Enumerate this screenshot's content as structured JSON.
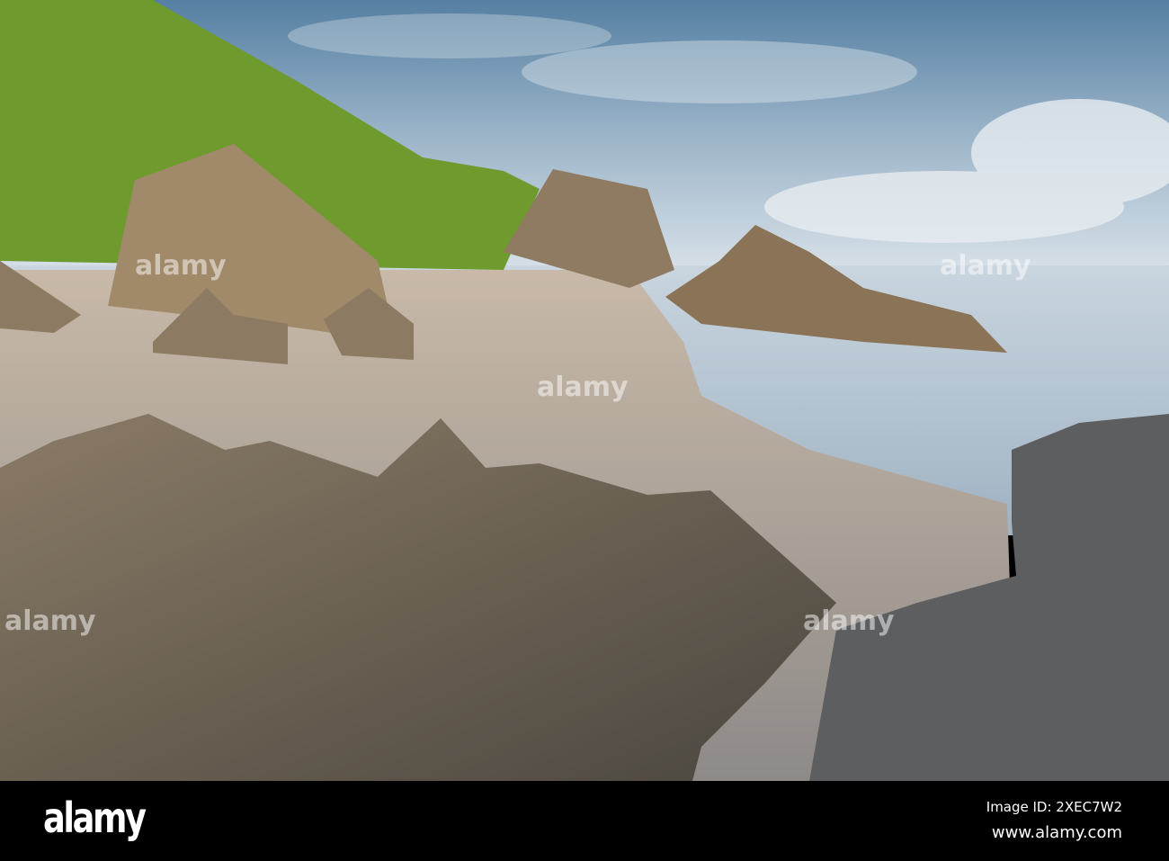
{
  "photo": {
    "subject": "rocky beach with cliffs",
    "colors": {
      "sky_top": "#5f8fb4",
      "sky_bottom": "#c9d7e2",
      "sea": "#b7c6d3",
      "sand": "#bfb3a6",
      "cliff_green": "#6f9a2e",
      "rock": "#7a6d5c"
    }
  },
  "watermark": {
    "text": "alamy"
  },
  "footer": {
    "logo": "alamy",
    "image_id": "Image ID: 2XEC7W2",
    "website": "www.alamy.com"
  }
}
